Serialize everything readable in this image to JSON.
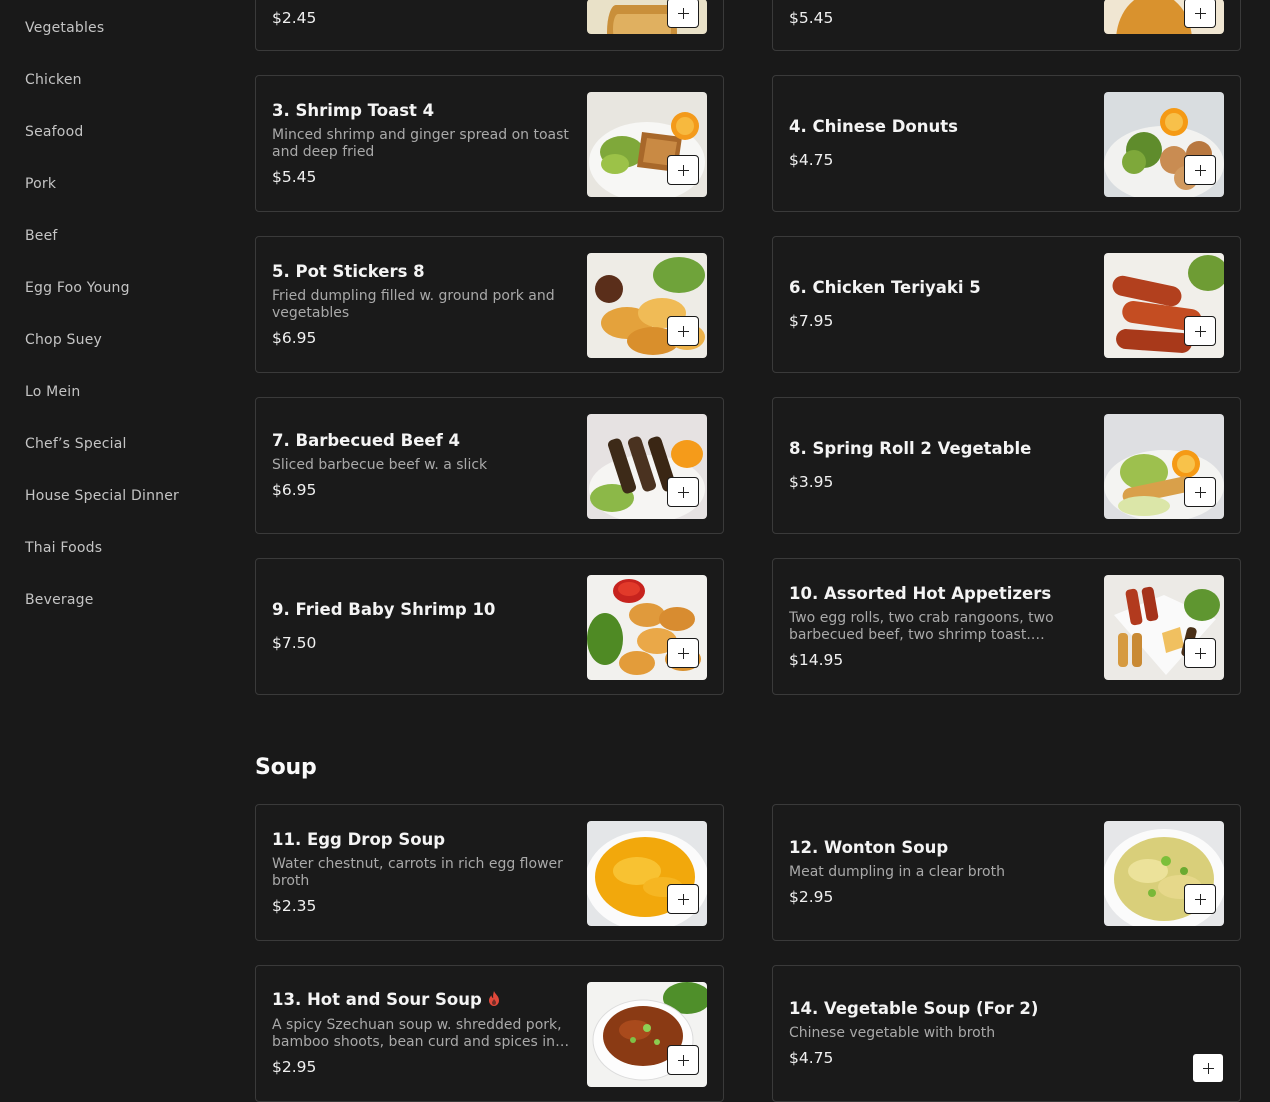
{
  "sidebar": {
    "items": [
      {
        "label": "Vegetables"
      },
      {
        "label": "Chicken"
      },
      {
        "label": "Seafood"
      },
      {
        "label": "Pork"
      },
      {
        "label": "Beef"
      },
      {
        "label": "Egg Foo Young"
      },
      {
        "label": "Chop Suey"
      },
      {
        "label": "Lo Mein"
      },
      {
        "label": "Chef’s Special"
      },
      {
        "label": "House Special Dinner"
      },
      {
        "label": "Thai Foods"
      },
      {
        "label": "Beverage"
      }
    ]
  },
  "appetizers": {
    "items": [
      {
        "price": "$2.45",
        "image": "egg-roll-photo"
      },
      {
        "price": "$5.45",
        "image": "fried-food-photo"
      },
      {
        "title": "3. Shrimp Toast 4",
        "desc": "Minced shrimp and ginger spread on toast and deep fried",
        "price": "$5.45",
        "image": "shrimp-toast-photo"
      },
      {
        "title": "4. Chinese Donuts",
        "price": "$4.75",
        "image": "chinese-donuts-photo"
      },
      {
        "title": "5. Pot Stickers 8",
        "desc": "Fried dumpling filled w. ground pork and vegetables",
        "price": "$6.95",
        "image": "pot-stickers-photo"
      },
      {
        "title": "6. Chicken Teriyaki 5",
        "price": "$7.95",
        "image": "chicken-teriyaki-photo"
      },
      {
        "title": "7. Barbecued Beef 4",
        "desc": "Sliced barbecue beef w. a slick",
        "price": "$6.95",
        "image": "barbecued-beef-photo"
      },
      {
        "title": "8. Spring Roll 2 Vegetable",
        "price": "$3.95",
        "image": "spring-roll-photo"
      },
      {
        "title": "9. Fried Baby Shrimp 10",
        "price": "$7.50",
        "image": "fried-shrimp-photo"
      },
      {
        "title": "10. Assorted Hot Appetizers",
        "desc": "Two egg rolls, two crab rangoons, two barbecued beef, two shrimp toast. Chicken teriyaki",
        "price": "$14.95",
        "image": "assorted-appetizers-photo"
      }
    ]
  },
  "soup": {
    "title": "Soup",
    "items": [
      {
        "title": "11. Egg Drop Soup",
        "desc": "Water chestnut, carrots in rich egg flower broth",
        "price": "$2.35",
        "image": "egg-drop-soup-photo"
      },
      {
        "title": "12. Wonton Soup",
        "desc": "Meat dumpling in a clear broth",
        "price": "$2.95",
        "image": "wonton-soup-photo"
      },
      {
        "title": "13. Hot and Sour Soup",
        "desc": "A spicy Szechuan soup w. shredded pork, bamboo shoots, bean curd and spices in a thick broth",
        "price": "$2.95",
        "image": "hot-sour-soup-photo",
        "spicy_icon": "flame-icon"
      },
      {
        "title": "14. Vegetable Soup (For 2)",
        "desc": "Chinese vegetable with broth",
        "price": "$4.75"
      }
    ]
  },
  "colors": {
    "background": "#191919",
    "card_border": "#3a3a3a",
    "spicy": "#e0483a"
  }
}
